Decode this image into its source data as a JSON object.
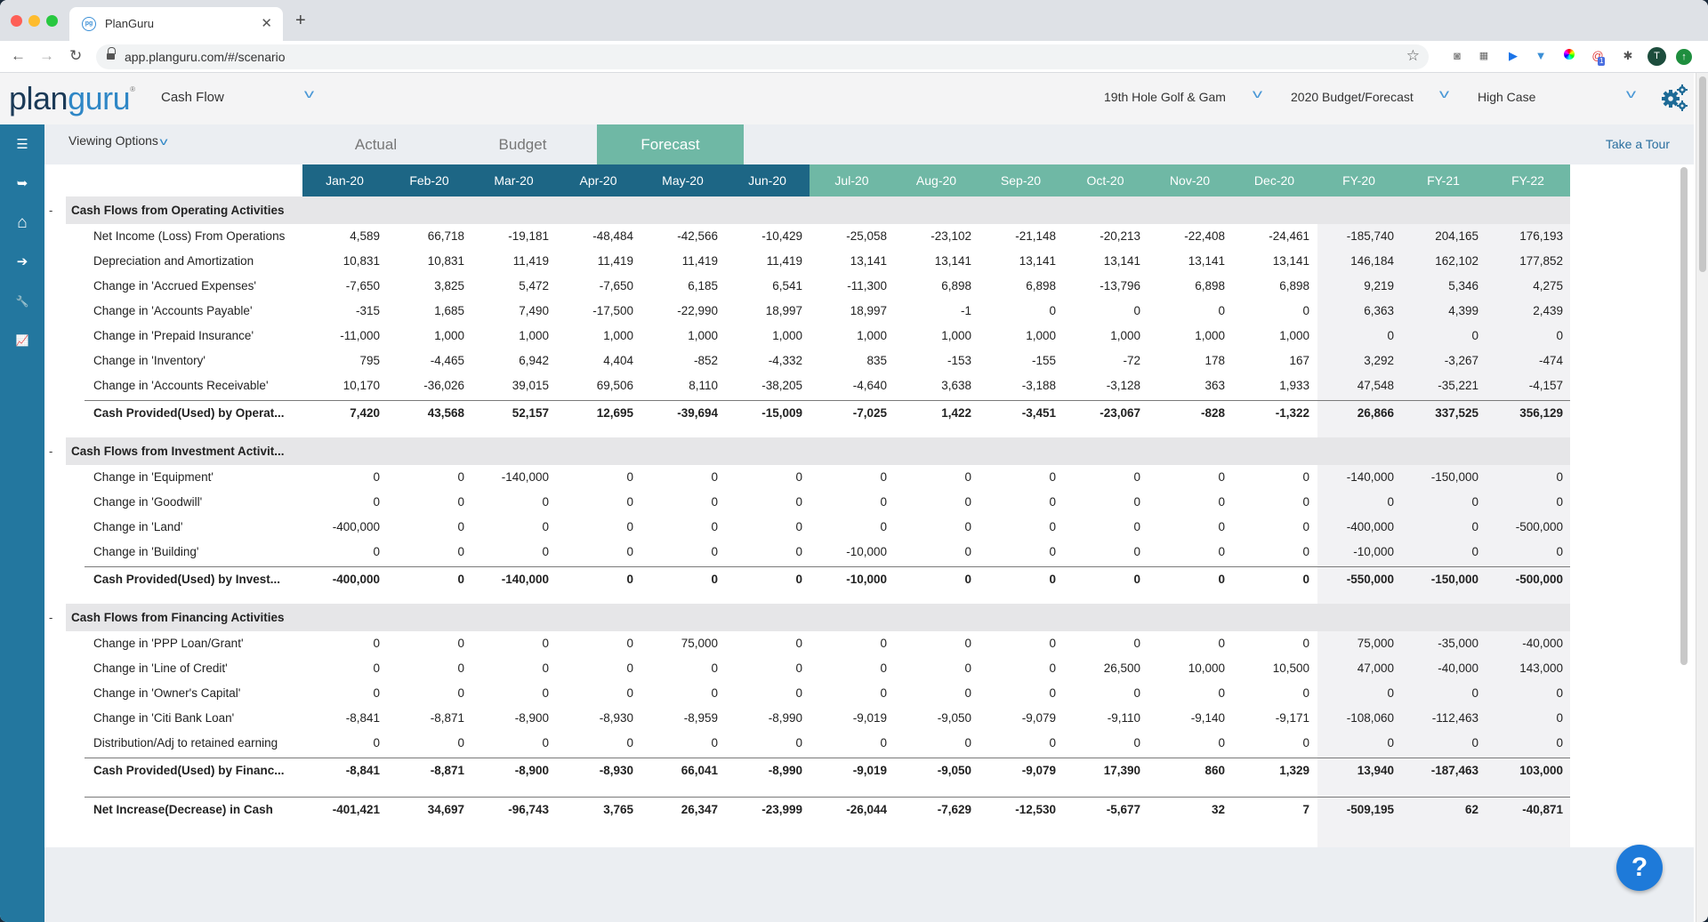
{
  "browser": {
    "tab_title": "PlanGuru",
    "favicon_text": "pg",
    "url": "app.planguru.com/#/scenario",
    "profile_initial": "T",
    "extension_badge": "1"
  },
  "header": {
    "logo_plan": "plan",
    "logo_guru": "guru",
    "logo_mark": "®",
    "report_select": "Cash Flow",
    "company_select": "19th Hole Golf & Gam",
    "budget_select": "2020 Budget/Forecast",
    "case_select": "High Case"
  },
  "sidebar": {
    "items": [
      {
        "icon": "menu-icon",
        "glyph": "☰"
      },
      {
        "icon": "sign-out-icon",
        "glyph": "➥"
      },
      {
        "icon": "home-icon",
        "glyph": "⌂"
      },
      {
        "icon": "arrow-circle-right-icon",
        "glyph": "➔"
      },
      {
        "icon": "wrench-icon",
        "glyph": "🔧"
      },
      {
        "icon": "line-chart-icon",
        "glyph": "📈"
      }
    ]
  },
  "toolbar": {
    "viewing_options": "Viewing Options",
    "tabs": [
      {
        "label": "Actual",
        "active": false
      },
      {
        "label": "Budget",
        "active": false
      },
      {
        "label": "Forecast",
        "active": true
      }
    ],
    "take_tour": "Take a Tour"
  },
  "columns": [
    {
      "label": "Jan-20",
      "kind": "actual"
    },
    {
      "label": "Feb-20",
      "kind": "actual"
    },
    {
      "label": "Mar-20",
      "kind": "actual"
    },
    {
      "label": "Apr-20",
      "kind": "actual"
    },
    {
      "label": "May-20",
      "kind": "actual"
    },
    {
      "label": "Jun-20",
      "kind": "actual"
    },
    {
      "label": "Jul-20",
      "kind": "forecast"
    },
    {
      "label": "Aug-20",
      "kind": "forecast"
    },
    {
      "label": "Sep-20",
      "kind": "forecast"
    },
    {
      "label": "Oct-20",
      "kind": "forecast"
    },
    {
      "label": "Nov-20",
      "kind": "forecast"
    },
    {
      "label": "Dec-20",
      "kind": "forecast"
    },
    {
      "label": "FY-20",
      "kind": "forecast"
    },
    {
      "label": "FY-21",
      "kind": "forecast"
    },
    {
      "label": "FY-22",
      "kind": "forecast"
    }
  ],
  "rows": [
    {
      "type": "section",
      "label": "Cash Flows from Operating Activities",
      "collapse": "-"
    },
    {
      "type": "item",
      "label": "Net Income (Loss) From Operations",
      "values": [
        "4,589",
        "66,718",
        "-19,181",
        "-48,484",
        "-42,566",
        "-10,429",
        "-25,058",
        "-23,102",
        "-21,148",
        "-20,213",
        "-22,408",
        "-24,461",
        "-185,740",
        "204,165",
        "176,193"
      ]
    },
    {
      "type": "item",
      "label": "Depreciation and Amortization",
      "values": [
        "10,831",
        "10,831",
        "11,419",
        "11,419",
        "11,419",
        "11,419",
        "13,141",
        "13,141",
        "13,141",
        "13,141",
        "13,141",
        "13,141",
        "146,184",
        "162,102",
        "177,852"
      ]
    },
    {
      "type": "item",
      "label": "Change in 'Accrued Expenses'",
      "values": [
        "-7,650",
        "3,825",
        "5,472",
        "-7,650",
        "6,185",
        "6,541",
        "-11,300",
        "6,898",
        "6,898",
        "-13,796",
        "6,898",
        "6,898",
        "9,219",
        "5,346",
        "4,275"
      ]
    },
    {
      "type": "item",
      "label": "Change in 'Accounts Payable'",
      "values": [
        "-315",
        "1,685",
        "7,490",
        "-17,500",
        "-22,990",
        "18,997",
        "18,997",
        "-1",
        "0",
        "0",
        "0",
        "0",
        "6,363",
        "4,399",
        "2,439"
      ]
    },
    {
      "type": "item",
      "label": "Change in 'Prepaid Insurance'",
      "values": [
        "-11,000",
        "1,000",
        "1,000",
        "1,000",
        "1,000",
        "1,000",
        "1,000",
        "1,000",
        "1,000",
        "1,000",
        "1,000",
        "1,000",
        "0",
        "0",
        "0"
      ]
    },
    {
      "type": "item",
      "label": "Change in 'Inventory'",
      "values": [
        "795",
        "-4,465",
        "6,942",
        "4,404",
        "-852",
        "-4,332",
        "835",
        "-153",
        "-155",
        "-72",
        "178",
        "167",
        "3,292",
        "-3,267",
        "-474"
      ]
    },
    {
      "type": "item",
      "label": "Change in 'Accounts Receivable'",
      "values": [
        "10,170",
        "-36,026",
        "39,015",
        "69,506",
        "8,110",
        "-38,205",
        "-4,640",
        "3,638",
        "-3,188",
        "-3,128",
        "363",
        "1,933",
        "47,548",
        "-35,221",
        "-4,157"
      ]
    },
    {
      "type": "total",
      "label": "Cash Provided(Used) by Operat...",
      "values": [
        "7,420",
        "43,568",
        "52,157",
        "12,695",
        "-39,694",
        "-15,009",
        "-7,025",
        "1,422",
        "-3,451",
        "-23,067",
        "-828",
        "-1,322",
        "26,866",
        "337,525",
        "356,129"
      ]
    },
    {
      "type": "section",
      "label": "Cash Flows from Investment Activit...",
      "collapse": "-"
    },
    {
      "type": "item",
      "label": "Change in 'Equipment'",
      "values": [
        "0",
        "0",
        "-140,000",
        "0",
        "0",
        "0",
        "0",
        "0",
        "0",
        "0",
        "0",
        "0",
        "-140,000",
        "-150,000",
        "0"
      ]
    },
    {
      "type": "item",
      "label": "Change in 'Goodwill'",
      "values": [
        "0",
        "0",
        "0",
        "0",
        "0",
        "0",
        "0",
        "0",
        "0",
        "0",
        "0",
        "0",
        "0",
        "0",
        "0"
      ]
    },
    {
      "type": "item",
      "label": "Change in 'Land'",
      "values": [
        "-400,000",
        "0",
        "0",
        "0",
        "0",
        "0",
        "0",
        "0",
        "0",
        "0",
        "0",
        "0",
        "-400,000",
        "0",
        "-500,000"
      ]
    },
    {
      "type": "item",
      "label": "Change in 'Building'",
      "values": [
        "0",
        "0",
        "0",
        "0",
        "0",
        "0",
        "-10,000",
        "0",
        "0",
        "0",
        "0",
        "0",
        "-10,000",
        "0",
        "0"
      ]
    },
    {
      "type": "total",
      "label": "Cash Provided(Used) by Invest...",
      "values": [
        "-400,000",
        "0",
        "-140,000",
        "0",
        "0",
        "0",
        "-10,000",
        "0",
        "0",
        "0",
        "0",
        "0",
        "-550,000",
        "-150,000",
        "-500,000"
      ]
    },
    {
      "type": "section",
      "label": "Cash Flows from Financing Activities",
      "collapse": "-"
    },
    {
      "type": "item",
      "label": "Change in 'PPP Loan/Grant'",
      "values": [
        "0",
        "0",
        "0",
        "0",
        "75,000",
        "0",
        "0",
        "0",
        "0",
        "0",
        "0",
        "0",
        "75,000",
        "-35,000",
        "-40,000"
      ]
    },
    {
      "type": "item",
      "label": "Change in 'Line of Credit'",
      "values": [
        "0",
        "0",
        "0",
        "0",
        "0",
        "0",
        "0",
        "0",
        "0",
        "26,500",
        "10,000",
        "10,500",
        "47,000",
        "-40,000",
        "143,000"
      ]
    },
    {
      "type": "item",
      "label": "Change in 'Owner's Capital'",
      "values": [
        "0",
        "0",
        "0",
        "0",
        "0",
        "0",
        "0",
        "0",
        "0",
        "0",
        "0",
        "0",
        "0",
        "0",
        "0"
      ]
    },
    {
      "type": "item",
      "label": "Change in 'Citi Bank Loan'",
      "values": [
        "-8,841",
        "-8,871",
        "-8,900",
        "-8,930",
        "-8,959",
        "-8,990",
        "-9,019",
        "-9,050",
        "-9,079",
        "-9,110",
        "-9,140",
        "-9,171",
        "-108,060",
        "-112,463",
        "0"
      ]
    },
    {
      "type": "item",
      "label": "Distribution/Adj to retained earning",
      "values": [
        "0",
        "0",
        "0",
        "0",
        "0",
        "0",
        "0",
        "0",
        "0",
        "0",
        "0",
        "0",
        "0",
        "0",
        "0"
      ]
    },
    {
      "type": "total",
      "label": "Cash Provided(Used) by Financ...",
      "values": [
        "-8,841",
        "-8,871",
        "-8,900",
        "-8,930",
        "66,041",
        "-8,990",
        "-9,019",
        "-9,050",
        "-9,079",
        "17,390",
        "860",
        "1,329",
        "13,940",
        "-187,463",
        "103,000"
      ]
    },
    {
      "type": "grand",
      "label": "Net Increase(Decrease) in Cash",
      "values": [
        "-401,421",
        "34,697",
        "-96,743",
        "3,765",
        "26,347",
        "-23,999",
        "-26,044",
        "-7,629",
        "-12,530",
        "-5,677",
        "32",
        "7",
        "-509,195",
        "62",
        "-40,871"
      ]
    }
  ],
  "help_button": "?",
  "colors": {
    "sidebar": "#23779f",
    "actual_header": "#1d6685",
    "forecast_header": "#6fb8a5",
    "link": "#2a6f9f",
    "help": "#1e7ad9"
  }
}
